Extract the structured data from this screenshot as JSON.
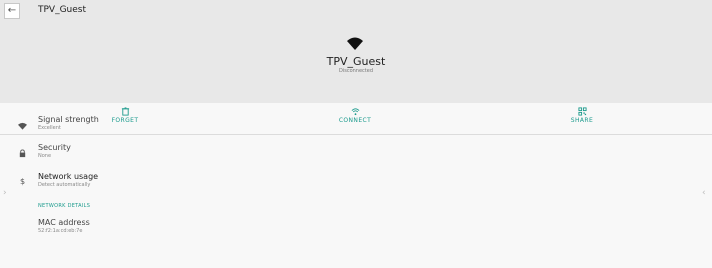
{
  "topbar": {
    "title": "TPV_Guest",
    "back_icon": "arrow-back-icon"
  },
  "header": {
    "name": "TPV_Guest",
    "status": "Disconnected",
    "icon": "wifi-icon"
  },
  "actions": [
    {
      "label": "FORGET",
      "icon": "trash-icon"
    },
    {
      "label": "CONNECT",
      "icon": "wifi-icon"
    },
    {
      "label": "SHARE",
      "icon": "qr-code-icon"
    }
  ],
  "details": [
    {
      "title": "Signal strength",
      "subtitle": "Excellent",
      "icon": "wifi-icon"
    },
    {
      "title": "Security",
      "subtitle": "None",
      "icon": "lock-icon"
    },
    {
      "title": "Network usage",
      "subtitle": "Detect automatically",
      "icon": "dollar-icon"
    }
  ],
  "section": {
    "label": "NETWORK DETAILS"
  },
  "mac": {
    "title": "MAC address",
    "value": "52:f2:1a:cd:eb:7e"
  },
  "colors": {
    "accent": "#1a9a8c",
    "header_bg": "#e8e8e8",
    "page_bg": "#f8f8f8"
  }
}
